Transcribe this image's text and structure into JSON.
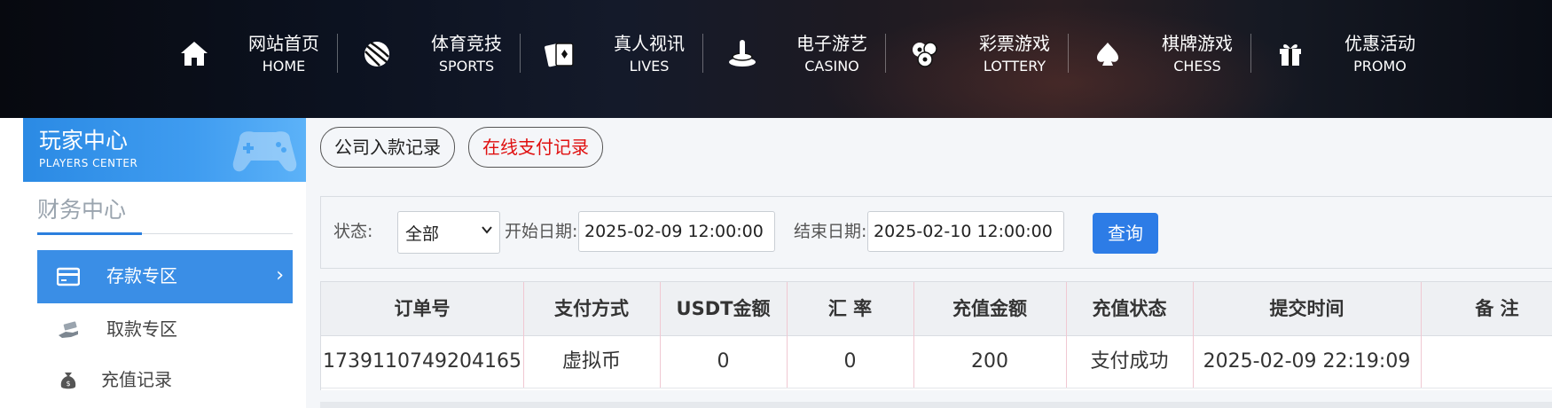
{
  "nav": {
    "items": [
      {
        "cn": "网站首页",
        "en": "HOME",
        "icon": "home-icon"
      },
      {
        "cn": "体育竞技",
        "en": "SPORTS",
        "icon": "basketball-icon"
      },
      {
        "cn": "真人视讯",
        "en": "LIVES",
        "icon": "playing-cards-icon"
      },
      {
        "cn": "电子游艺",
        "en": "CASINO",
        "icon": "slot-machine-icon"
      },
      {
        "cn": "彩票游戏",
        "en": "LOTTERY",
        "icon": "lottery-balls-icon"
      },
      {
        "cn": "棋牌游戏",
        "en": "CHESS",
        "icon": "spade-icon"
      },
      {
        "cn": "优惠活动",
        "en": "PROMO",
        "icon": "gift-icon"
      }
    ]
  },
  "sidebar": {
    "header_title": "玩家中心",
    "header_sub": "PLAYERS CENTER",
    "section_title": "财务中心",
    "menu": [
      {
        "label": "存款专区",
        "icon": "deposit-card-icon",
        "active": true
      },
      {
        "label": "取款专区",
        "icon": "withdraw-hand-icon",
        "active": false
      },
      {
        "label": "充值记录",
        "icon": "money-bag-icon",
        "active": false
      }
    ]
  },
  "tabs": {
    "company": "公司入款记录",
    "online": "在线支付记录"
  },
  "filter": {
    "status_label": "状态:",
    "status_value": "全部",
    "start_label": "开始日期:",
    "start_value": "2025-02-09 12:00:00",
    "end_label": "结束日期:",
    "end_value": "2025-02-10 12:00:00",
    "query_label": "查询"
  },
  "table": {
    "headers": [
      "订单号",
      "支付方式",
      "USDT金额",
      "汇 率",
      "充值金额",
      "充值状态",
      "提交时间",
      "备 注"
    ],
    "rows": [
      [
        "1739110749204165",
        "虚拟币",
        "0",
        "0",
        "200",
        "支付成功",
        "2025-02-09 22:19:09",
        ""
      ]
    ]
  },
  "colors": {
    "accent": "#2d7ce6",
    "online_tab_text": "#e01010",
    "sidebar_active": "#3a8ee6"
  }
}
